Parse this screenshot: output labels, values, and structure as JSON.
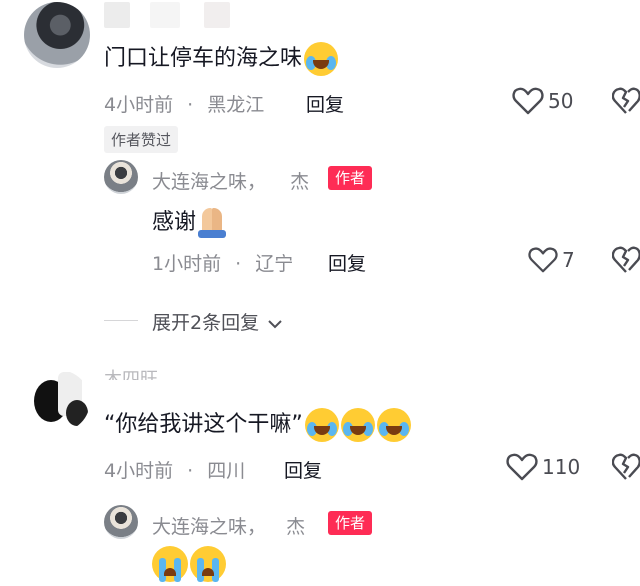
{
  "comments": [
    {
      "text": "门口让停车的海之味",
      "meta_time": "4小时前",
      "meta_location": "黑龙江",
      "reply_label": "回复",
      "likes": "50",
      "liked_by_author_tag": "作者赞过",
      "expand_label": "展开2条回复",
      "replies": [
        {
          "username": "大连海之味，",
          "username_suffix": "杰",
          "author_tag": "作者",
          "text": "感谢",
          "meta_time": "1小时前",
          "meta_location": "辽宁",
          "reply_label": "回复",
          "likes": "7"
        }
      ]
    },
    {
      "username_partial": "木四旺",
      "text": "“你给我讲这个干嘛”",
      "meta_time": "4小时前",
      "meta_location": "四川",
      "reply_label": "回复",
      "likes": "110",
      "replies": [
        {
          "username": "大连海之味，",
          "username_suffix": "杰",
          "author_tag": "作者"
        }
      ]
    }
  ],
  "separator_dot": "·",
  "icons": {
    "like": "heart-outline-icon",
    "dislike": "broken-heart-icon",
    "expand": "chevron-down-icon",
    "emoji_laugh": "laugh-cry-emoji",
    "emoji_pray": "pray-emoji",
    "emoji_cry": "loud-cry-emoji"
  },
  "colors": {
    "author_tag_bg": "#fe2c55",
    "meta_text": "#8a8b91",
    "primary_text": "#161823"
  }
}
